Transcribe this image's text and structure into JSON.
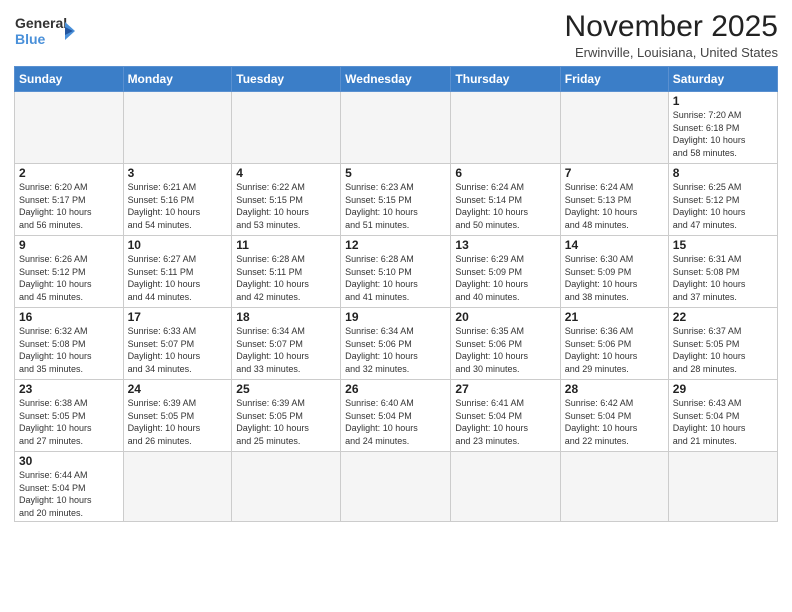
{
  "logo": {
    "text_general": "General",
    "text_blue": "Blue"
  },
  "title": "November 2025",
  "location": "Erwinville, Louisiana, United States",
  "days_of_week": [
    "Sunday",
    "Monday",
    "Tuesday",
    "Wednesday",
    "Thursday",
    "Friday",
    "Saturday"
  ],
  "weeks": [
    [
      {
        "day": "",
        "info": ""
      },
      {
        "day": "",
        "info": ""
      },
      {
        "day": "",
        "info": ""
      },
      {
        "day": "",
        "info": ""
      },
      {
        "day": "",
        "info": ""
      },
      {
        "day": "",
        "info": ""
      },
      {
        "day": "1",
        "info": "Sunrise: 7:20 AM\nSunset: 6:18 PM\nDaylight: 10 hours\nand 58 minutes."
      }
    ],
    [
      {
        "day": "2",
        "info": "Sunrise: 6:20 AM\nSunset: 5:17 PM\nDaylight: 10 hours\nand 56 minutes."
      },
      {
        "day": "3",
        "info": "Sunrise: 6:21 AM\nSunset: 5:16 PM\nDaylight: 10 hours\nand 54 minutes."
      },
      {
        "day": "4",
        "info": "Sunrise: 6:22 AM\nSunset: 5:15 PM\nDaylight: 10 hours\nand 53 minutes."
      },
      {
        "day": "5",
        "info": "Sunrise: 6:23 AM\nSunset: 5:15 PM\nDaylight: 10 hours\nand 51 minutes."
      },
      {
        "day": "6",
        "info": "Sunrise: 6:24 AM\nSunset: 5:14 PM\nDaylight: 10 hours\nand 50 minutes."
      },
      {
        "day": "7",
        "info": "Sunrise: 6:24 AM\nSunset: 5:13 PM\nDaylight: 10 hours\nand 48 minutes."
      },
      {
        "day": "8",
        "info": "Sunrise: 6:25 AM\nSunset: 5:12 PM\nDaylight: 10 hours\nand 47 minutes."
      }
    ],
    [
      {
        "day": "9",
        "info": "Sunrise: 6:26 AM\nSunset: 5:12 PM\nDaylight: 10 hours\nand 45 minutes."
      },
      {
        "day": "10",
        "info": "Sunrise: 6:27 AM\nSunset: 5:11 PM\nDaylight: 10 hours\nand 44 minutes."
      },
      {
        "day": "11",
        "info": "Sunrise: 6:28 AM\nSunset: 5:11 PM\nDaylight: 10 hours\nand 42 minutes."
      },
      {
        "day": "12",
        "info": "Sunrise: 6:28 AM\nSunset: 5:10 PM\nDaylight: 10 hours\nand 41 minutes."
      },
      {
        "day": "13",
        "info": "Sunrise: 6:29 AM\nSunset: 5:09 PM\nDaylight: 10 hours\nand 40 minutes."
      },
      {
        "day": "14",
        "info": "Sunrise: 6:30 AM\nSunset: 5:09 PM\nDaylight: 10 hours\nand 38 minutes."
      },
      {
        "day": "15",
        "info": "Sunrise: 6:31 AM\nSunset: 5:08 PM\nDaylight: 10 hours\nand 37 minutes."
      }
    ],
    [
      {
        "day": "16",
        "info": "Sunrise: 6:32 AM\nSunset: 5:08 PM\nDaylight: 10 hours\nand 35 minutes."
      },
      {
        "day": "17",
        "info": "Sunrise: 6:33 AM\nSunset: 5:07 PM\nDaylight: 10 hours\nand 34 minutes."
      },
      {
        "day": "18",
        "info": "Sunrise: 6:34 AM\nSunset: 5:07 PM\nDaylight: 10 hours\nand 33 minutes."
      },
      {
        "day": "19",
        "info": "Sunrise: 6:34 AM\nSunset: 5:06 PM\nDaylight: 10 hours\nand 32 minutes."
      },
      {
        "day": "20",
        "info": "Sunrise: 6:35 AM\nSunset: 5:06 PM\nDaylight: 10 hours\nand 30 minutes."
      },
      {
        "day": "21",
        "info": "Sunrise: 6:36 AM\nSunset: 5:06 PM\nDaylight: 10 hours\nand 29 minutes."
      },
      {
        "day": "22",
        "info": "Sunrise: 6:37 AM\nSunset: 5:05 PM\nDaylight: 10 hours\nand 28 minutes."
      }
    ],
    [
      {
        "day": "23",
        "info": "Sunrise: 6:38 AM\nSunset: 5:05 PM\nDaylight: 10 hours\nand 27 minutes."
      },
      {
        "day": "24",
        "info": "Sunrise: 6:39 AM\nSunset: 5:05 PM\nDaylight: 10 hours\nand 26 minutes."
      },
      {
        "day": "25",
        "info": "Sunrise: 6:39 AM\nSunset: 5:05 PM\nDaylight: 10 hours\nand 25 minutes."
      },
      {
        "day": "26",
        "info": "Sunrise: 6:40 AM\nSunset: 5:04 PM\nDaylight: 10 hours\nand 24 minutes."
      },
      {
        "day": "27",
        "info": "Sunrise: 6:41 AM\nSunset: 5:04 PM\nDaylight: 10 hours\nand 23 minutes."
      },
      {
        "day": "28",
        "info": "Sunrise: 6:42 AM\nSunset: 5:04 PM\nDaylight: 10 hours\nand 22 minutes."
      },
      {
        "day": "29",
        "info": "Sunrise: 6:43 AM\nSunset: 5:04 PM\nDaylight: 10 hours\nand 21 minutes."
      }
    ],
    [
      {
        "day": "30",
        "info": "Sunrise: 6:44 AM\nSunset: 5:04 PM\nDaylight: 10 hours\nand 20 minutes."
      },
      {
        "day": "",
        "info": ""
      },
      {
        "day": "",
        "info": ""
      },
      {
        "day": "",
        "info": ""
      },
      {
        "day": "",
        "info": ""
      },
      {
        "day": "",
        "info": ""
      },
      {
        "day": "",
        "info": ""
      }
    ]
  ]
}
